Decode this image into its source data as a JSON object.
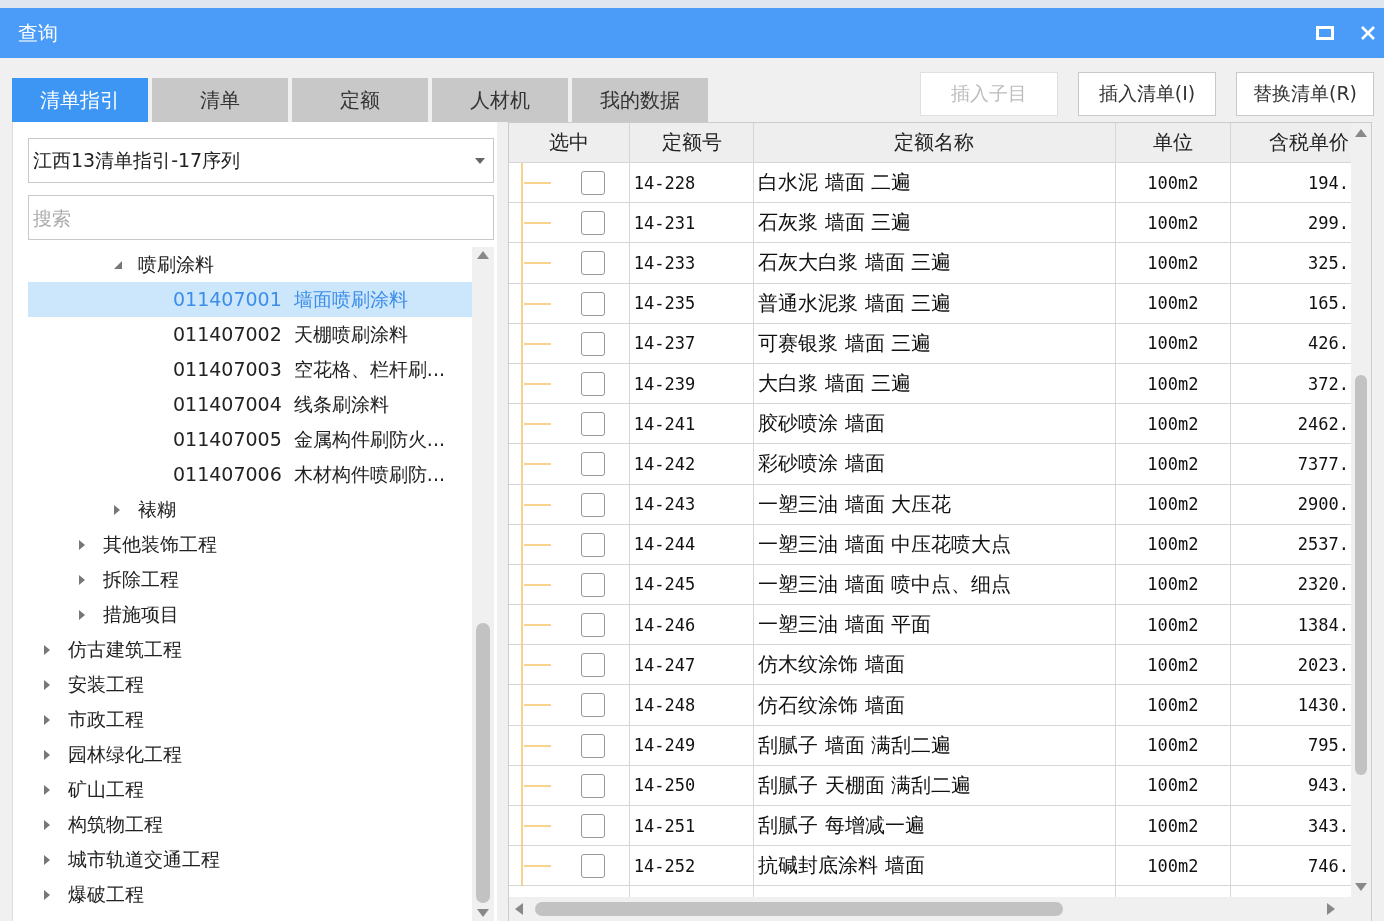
{
  "window": {
    "title": "查询"
  },
  "tabs": [
    {
      "label": "清单指引",
      "selected": true
    },
    {
      "label": "清单",
      "selected": false
    },
    {
      "label": "定额",
      "selected": false
    },
    {
      "label": "人材机",
      "selected": false
    },
    {
      "label": "我的数据",
      "selected": false
    }
  ],
  "buttons": [
    {
      "label": "插入子目",
      "disabled": true
    },
    {
      "label": "插入清单(I)",
      "disabled": false
    },
    {
      "label": "替换清单(R)",
      "disabled": false
    }
  ],
  "combo": {
    "value": "江西13清单指引-17序列"
  },
  "search": {
    "placeholder": "搜索"
  },
  "tree": [
    {
      "children": [
        {
          "children": [
            {
              "label": "喷刷涂料",
              "expanded": true,
              "selected": false,
              "children": [
                {
                  "code": "011407001",
                  "label": "墙面喷刷涂料",
                  "selected": true
                },
                {
                  "code": "011407002",
                  "label": "天棚喷刷涂料",
                  "selected": false
                },
                {
                  "code": "011407003",
                  "label": "空花格、栏杆刷...",
                  "selected": false
                },
                {
                  "code": "011407004",
                  "label": "线条刷涂料",
                  "selected": false
                },
                {
                  "code": "011407005",
                  "label": "金属构件刷防火...",
                  "selected": false
                },
                {
                  "code": "011407006",
                  "label": "木材构件喷刷防...",
                  "selected": false
                }
              ]
            },
            {
              "label": "裱糊",
              "expanded": false,
              "selected": false
            }
          ]
        },
        {
          "label": "其他装饰工程",
          "expanded": false,
          "selected": false
        },
        {
          "label": "拆除工程",
          "expanded": false,
          "selected": false
        },
        {
          "label": "措施项目",
          "expanded": false,
          "selected": false
        }
      ]
    },
    {
      "label": "仿古建筑工程",
      "expanded": false,
      "selected": false
    },
    {
      "label": "安装工程",
      "expanded": false,
      "selected": false
    },
    {
      "label": "市政工程",
      "expanded": false,
      "selected": false
    },
    {
      "label": "园林绿化工程",
      "expanded": false,
      "selected": false
    },
    {
      "label": "矿山工程",
      "expanded": false,
      "selected": false
    },
    {
      "label": "构筑物工程",
      "expanded": false,
      "selected": false
    },
    {
      "label": "城市轨道交通工程",
      "expanded": false,
      "selected": false
    },
    {
      "label": "爆破工程",
      "expanded": false,
      "selected": false
    }
  ],
  "table": {
    "columns": [
      "选中",
      "定额号",
      "定额名称",
      "单位",
      "含税单价"
    ],
    "rows": [
      {
        "checked": false,
        "code": "14-228",
        "name": "白水泥 墙面 二遍",
        "unit": "100m2",
        "price": "194."
      },
      {
        "checked": false,
        "code": "14-231",
        "name": "石灰浆 墙面 三遍",
        "unit": "100m2",
        "price": "299."
      },
      {
        "checked": false,
        "code": "14-233",
        "name": "石灰大白浆 墙面 三遍",
        "unit": "100m2",
        "price": "325."
      },
      {
        "checked": false,
        "code": "14-235",
        "name": "普通水泥浆 墙面 三遍",
        "unit": "100m2",
        "price": "165."
      },
      {
        "checked": false,
        "code": "14-237",
        "name": "可赛银浆 墙面 三遍",
        "unit": "100m2",
        "price": "426."
      },
      {
        "checked": false,
        "code": "14-239",
        "name": "大白浆 墙面 三遍",
        "unit": "100m2",
        "price": "372."
      },
      {
        "checked": false,
        "code": "14-241",
        "name": "胶砂喷涂 墙面",
        "unit": "100m2",
        "price": "2462."
      },
      {
        "checked": false,
        "code": "14-242",
        "name": "彩砂喷涂 墙面",
        "unit": "100m2",
        "price": "7377."
      },
      {
        "checked": false,
        "code": "14-243",
        "name": "一塑三油 墙面 大压花",
        "unit": "100m2",
        "price": "2900."
      },
      {
        "checked": false,
        "code": "14-244",
        "name": "一塑三油 墙面 中压花喷大点",
        "unit": "100m2",
        "price": "2537."
      },
      {
        "checked": false,
        "code": "14-245",
        "name": "一塑三油 墙面 喷中点、细点",
        "unit": "100m2",
        "price": "2320."
      },
      {
        "checked": false,
        "code": "14-246",
        "name": "一塑三油 墙面 平面",
        "unit": "100m2",
        "price": "1384."
      },
      {
        "checked": false,
        "code": "14-247",
        "name": "仿木纹涂饰 墙面",
        "unit": "100m2",
        "price": "2023."
      },
      {
        "checked": false,
        "code": "14-248",
        "name": "仿石纹涂饰 墙面",
        "unit": "100m2",
        "price": "1430."
      },
      {
        "checked": false,
        "code": "14-249",
        "name": "刮腻子 墙面 满刮二遍",
        "unit": "100m2",
        "price": "795."
      },
      {
        "checked": false,
        "code": "14-250",
        "name": "刮腻子 天棚面 满刮二遍",
        "unit": "100m2",
        "price": "943."
      },
      {
        "checked": false,
        "code": "14-251",
        "name": "刮腻子 每增减一遍",
        "unit": "100m2",
        "price": "343."
      },
      {
        "checked": false,
        "code": "14-252",
        "name": "抗碱封底涂料 墙面",
        "unit": "100m2",
        "price": "746."
      }
    ]
  }
}
